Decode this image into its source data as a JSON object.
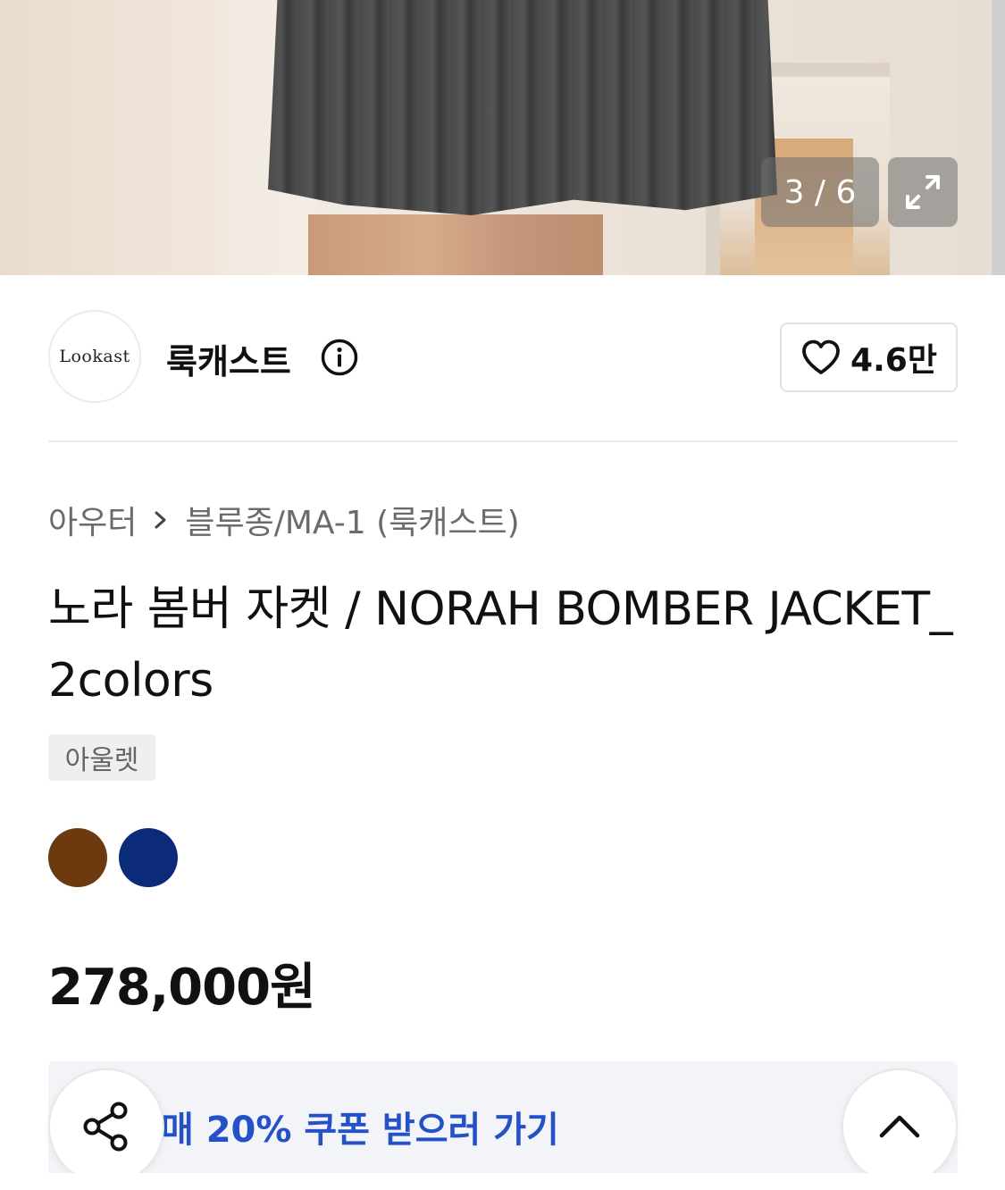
{
  "gallery": {
    "counter": "3 / 6"
  },
  "brand": {
    "logo_text": "Lookast",
    "name": "룩캐스트",
    "likes": "4.6만"
  },
  "breadcrumb": {
    "category": "아우터",
    "subcategory": "블루종/MA-1 (룩캐스트)"
  },
  "product": {
    "title": "노라 봄버 자켓 / NORAH BOMBER JACKET_2colors",
    "tag": "아울렛",
    "colors": [
      "#6b3a0f",
      "#0b2b7a"
    ],
    "price": "278,000원"
  },
  "coupon": {
    "text": "매 20% 쿠폰 받으러 가기",
    "color": "#2450c8"
  }
}
